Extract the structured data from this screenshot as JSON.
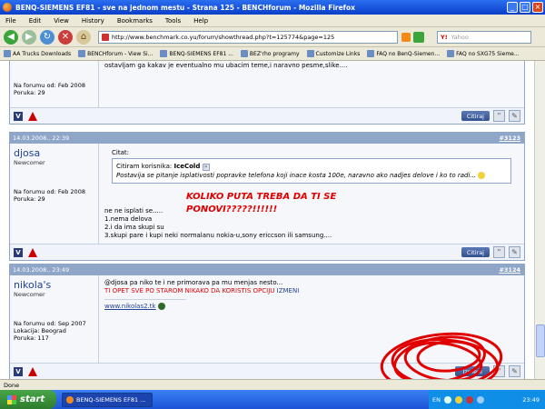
{
  "window": {
    "title": "BENQ-SIEMENS EF81 - sve na jednom mestu - Strana 125 - BENCHforum - Mozilla Firefox"
  },
  "menu": [
    "File",
    "Edit",
    "View",
    "History",
    "Bookmarks",
    "Tools",
    "Help"
  ],
  "nav": {
    "url": "http://www.benchmark.co.yu/forum/showthread.php?t=125774&page=125",
    "search_placeholder": "Yahoo"
  },
  "bookmarks": [
    "AA Trucks Downloads",
    "BENCHforum - View Si...",
    "BENQ-SIEMENS EF81 ...",
    "BEZ'rho programy",
    "Customize Links",
    "FAQ no BenQ-Siemen...",
    "FAQ no SXG75  Sieme..."
  ],
  "post0": {
    "partial_text": "ostavljam ga kakav je eventualno mu ubacim teme,i naravno pesme,slike....",
    "joined": "Na forumu od: Feb 2008",
    "posts": "Poruka: 29",
    "quote_label": "Citiraj"
  },
  "post1": {
    "date": "14.03.2008., 22:39",
    "number": "#3123",
    "username": "djosa",
    "usertitle": "Newcomer",
    "joined": "Na forumu od: Feb 2008",
    "posts": "Poruka: 29",
    "quote_label": "Citat:",
    "quote_prefix": "Citiram korisnika:",
    "quote_author": "IceCold",
    "quote_text": "Postavija se pitanje isplativosti popravke telefona koji inace kosta 100e, naravno ako nadjes delove i ko to radi...",
    "annotation_line1": "KOLIKO PUTA TREBA DA TI SE",
    "annotation_line2": "PONOVI?????!!!!!!",
    "lines": [
      "ne ne isplati se.....",
      "1.nema delova",
      "2.i da ima skupi su",
      "3.skupi pare i kupi neki normalanu nokia-u,sony ericcson ili samsung...."
    ],
    "btn_quote": "Citiraj"
  },
  "post2": {
    "date": "14.03.2008., 23:49",
    "number": "#3124",
    "username": "nikola's",
    "usertitle": "Newcomer",
    "joined": "Na forumu od: Sep 2007",
    "location": "Lokacija: Beograd",
    "posts": "Poruka: 117",
    "line1": "@djosa pa niko te i ne primorava pa mu menjas nesto...",
    "line2_red": "TI OPET SVE PO STAROM NIKAKO DA KORISTIS OPCIJU",
    "line2_blue": "IZMENI",
    "sig_link": "www.nikolas2.tk",
    "btn_edit": "Izmeni"
  },
  "status": "Done",
  "taskbar": {
    "start": "start",
    "task": "BENQ-SIEMENS EF81 ...",
    "lang": "EN",
    "clock": "23:49"
  },
  "colors": {
    "annotation_red": "#e00000",
    "post_header": "#8fa6c9",
    "link_blue": "#22429a"
  }
}
